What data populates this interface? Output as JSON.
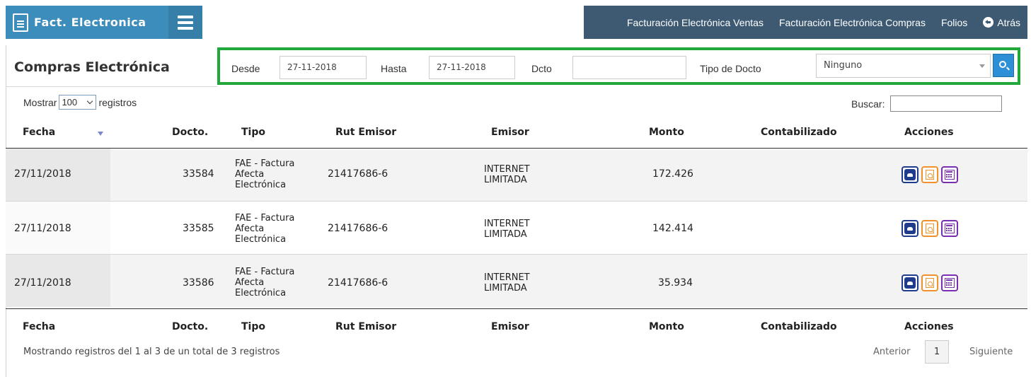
{
  "brand": {
    "title": "Fact. Electronica"
  },
  "topnav": {
    "items": [
      "Facturación Electrónica Ventas",
      "Facturación Electrónica Compras",
      "Folios"
    ],
    "back_label": "Atrás"
  },
  "page": {
    "title": "Compras Electrónica"
  },
  "filter": {
    "desde_label": "Desde",
    "desde_value": "27-11-2018",
    "hasta_label": "Hasta",
    "hasta_value": "27-11-2018",
    "dcto_label": "Dcto",
    "dcto_value": "",
    "tipo_label": "Tipo de Docto",
    "tipo_selected": "Ninguno"
  },
  "length": {
    "prefix": "Mostrar",
    "value": "100",
    "suffix": "registros"
  },
  "search": {
    "label": "Buscar:"
  },
  "table": {
    "columns": [
      "Fecha",
      "Docto.",
      "Tipo",
      "Rut Emisor",
      "Emisor",
      "Monto",
      "Contabilizado",
      "Acciones"
    ],
    "rows": [
      {
        "fecha": "27/11/2018",
        "docto": "33584",
        "tipo": [
          "FAE - Factura",
          "Afecta",
          "Electrónica"
        ],
        "rut": "21417686-6",
        "emisor": [
          "INTERNET",
          "LIMITADA"
        ],
        "monto": "172.426",
        "contabilizado": ""
      },
      {
        "fecha": "27/11/2018",
        "docto": "33585",
        "tipo": [
          "FAE - Factura",
          "Afecta",
          "Electrónica"
        ],
        "rut": "21417686-6",
        "emisor": [
          "INTERNET",
          "LIMITADA"
        ],
        "monto": "142.414",
        "contabilizado": ""
      },
      {
        "fecha": "27/11/2018",
        "docto": "33586",
        "tipo": [
          "FAE - Factura",
          "Afecta",
          "Electrónica"
        ],
        "rut": "21417686-6",
        "emisor": [
          "INTERNET",
          "LIMITADA"
        ],
        "monto": "35.934",
        "contabilizado": ""
      }
    ]
  },
  "footer": {
    "info": "Mostrando registros del 1 al 3 de un total de 3 registros",
    "prev": "Anterior",
    "page": "1",
    "next": "Siguiente"
  },
  "icons": {
    "brand": "document-icon",
    "menu": "hamburger-menu-icon",
    "back": "arrow-left-circle-icon",
    "search": "magnifier-icon",
    "row_actions": [
      "cloud-download-icon",
      "pdf-icon",
      "calculator-icon"
    ]
  },
  "colors": {
    "brand": "#3c8dbc",
    "topnav": "#3d5a72",
    "filter_border": "#22a83a",
    "search_button": "#2d8fd5"
  }
}
